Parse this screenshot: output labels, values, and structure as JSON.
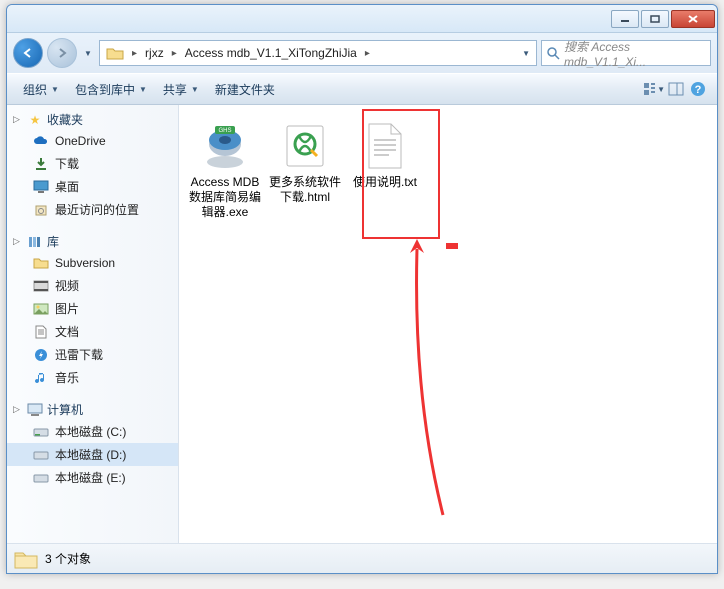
{
  "breadcrumb": {
    "seg1": "rjxz",
    "seg2": "Access mdb_V1.1_XiTongZhiJia"
  },
  "search": {
    "placeholder": "搜索 Access mdb_V1.1_Xi..."
  },
  "toolbar": {
    "organize": "组织",
    "include": "包含到库中",
    "share": "共享",
    "newfolder": "新建文件夹"
  },
  "sidebar": {
    "fav": {
      "header": "收藏夹",
      "items": [
        "OneDrive",
        "下载",
        "桌面",
        "最近访问的位置"
      ]
    },
    "lib": {
      "header": "库",
      "items": [
        "Subversion",
        "视频",
        "图片",
        "文档",
        "迅雷下载",
        "音乐"
      ]
    },
    "comp": {
      "header": "计算机",
      "items": [
        "本地磁盘 (C:)",
        "本地磁盘 (D:)",
        "本地磁盘 (E:)"
      ]
    }
  },
  "files": [
    {
      "name": "Access MDB数据库简易编辑器.exe",
      "icon": "disc"
    },
    {
      "name": "更多系统软件下载.html",
      "icon": "ie"
    },
    {
      "name": "使用说明.txt",
      "icon": "txt"
    }
  ],
  "status": {
    "count": "3 个对象"
  }
}
